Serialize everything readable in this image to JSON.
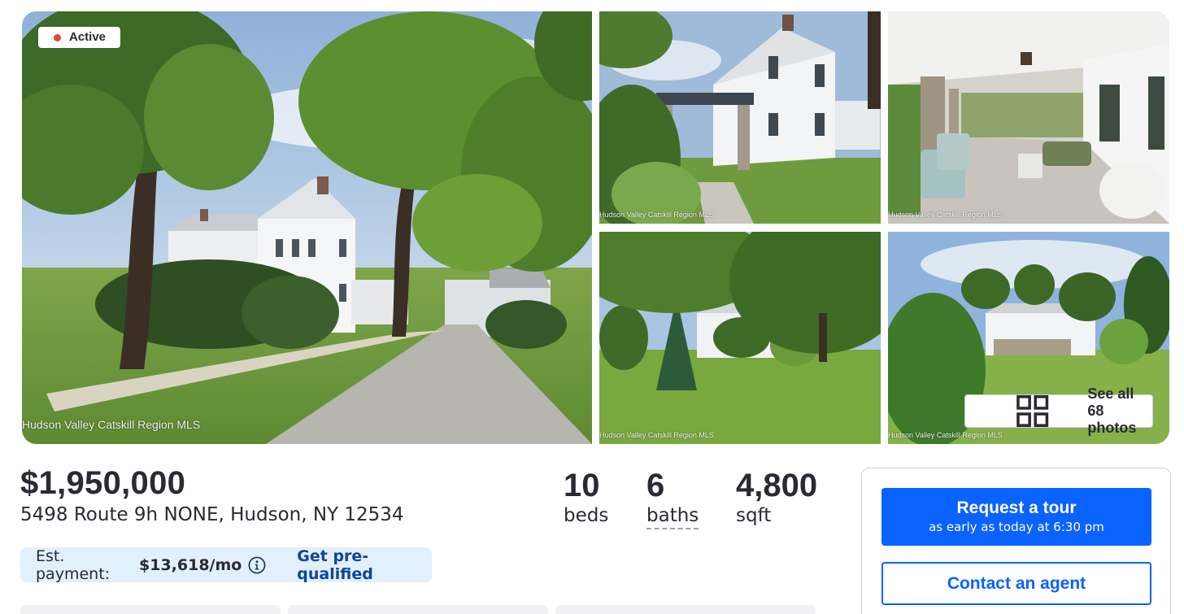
{
  "gallery": {
    "status_badge": "Active",
    "watermark": "Hudson Valley Catskill Region MLS",
    "see_all_label": "See all 68 photos",
    "photos": [
      {
        "description": "main-exterior-photo"
      },
      {
        "description": "side-exterior-photo"
      },
      {
        "description": "porch-photo"
      },
      {
        "description": "yard-photo"
      },
      {
        "description": "rear-exterior-photo"
      }
    ]
  },
  "listing": {
    "price": "$1,950,000",
    "address": "5498 Route 9h NONE, Hudson, NY 12534",
    "beds_value": "10",
    "beds_label": "beds",
    "baths_value": "6",
    "baths_label": "baths",
    "sqft_value": "4,800",
    "sqft_label": "sqft"
  },
  "payment": {
    "label": "Est. payment:",
    "value": "$13,618/mo",
    "prequal_label": "Get pre-qualified"
  },
  "contact": {
    "tour_title": "Request a tour",
    "tour_subtitle": "as early as today at 6:30 pm",
    "agent_label": "Contact an agent"
  },
  "colors": {
    "brand_blue": "#0a62ff",
    "link_blue": "#0d4599",
    "payment_bg": "#e2effd",
    "active_dot": "#e4453a",
    "text": "#2a2a33"
  }
}
